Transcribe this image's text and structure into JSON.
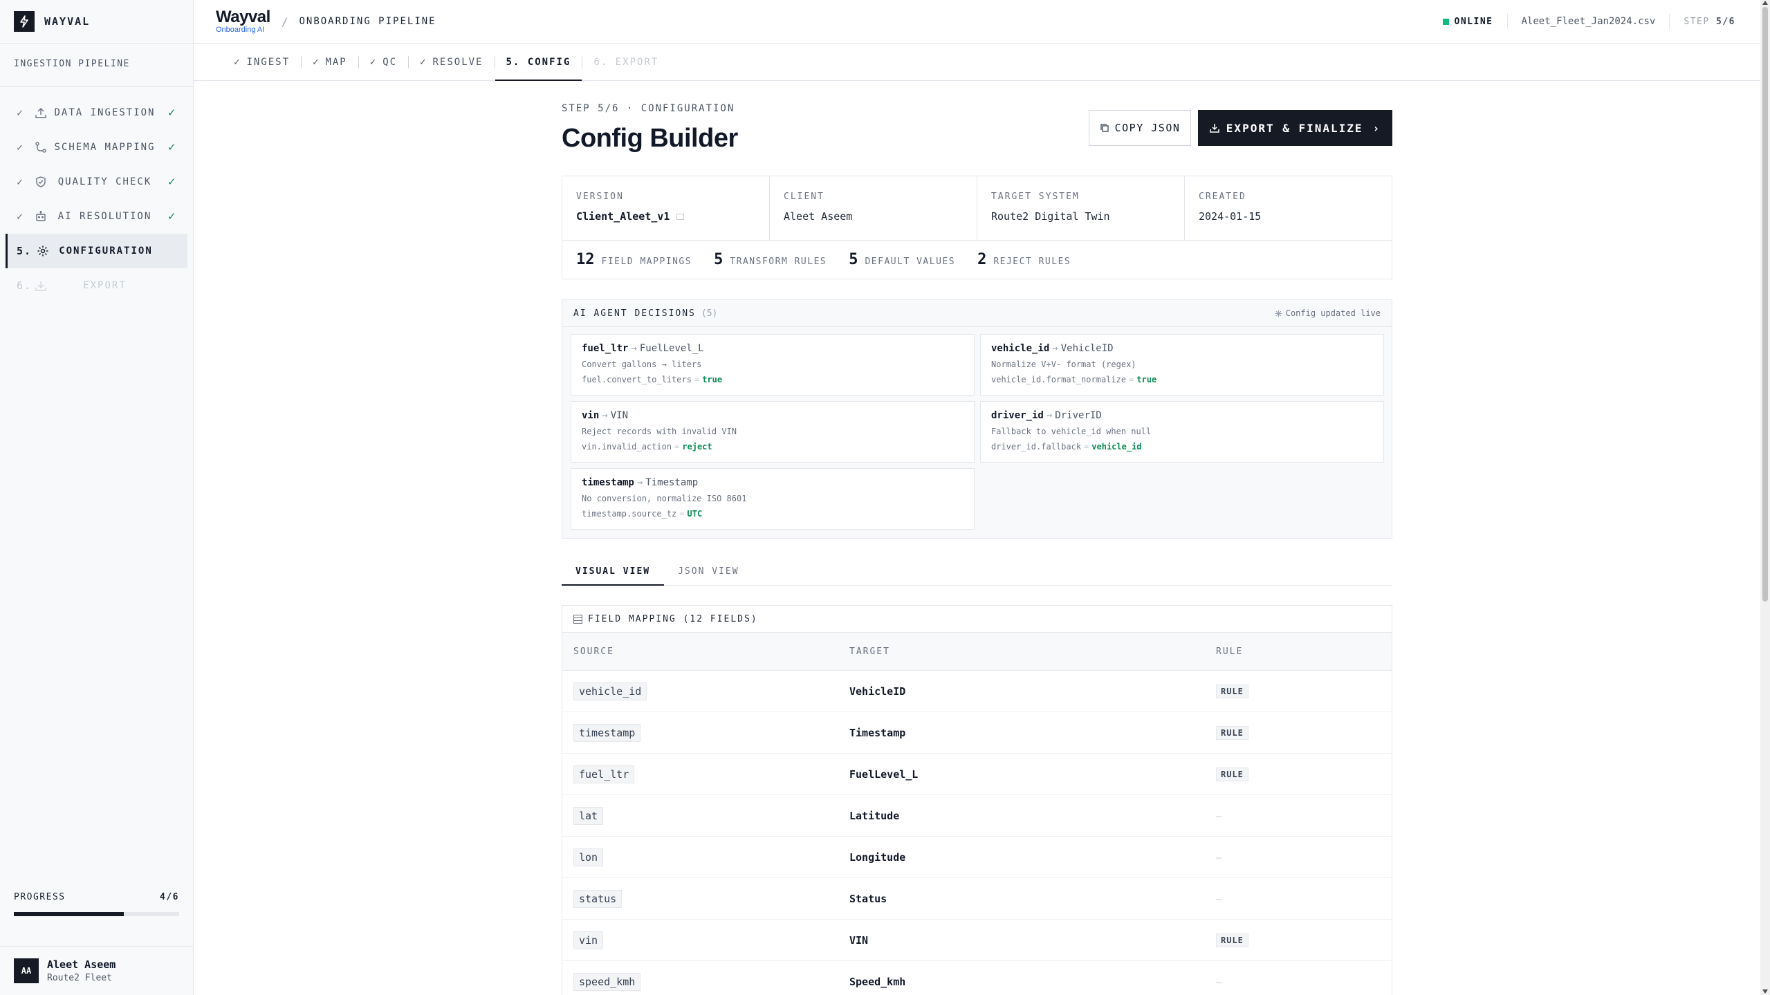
{
  "brand": {
    "name": "WAYVAL",
    "icon": "lightning-bolt-icon"
  },
  "sidebar": {
    "section_title": "INGESTION PIPELINE",
    "items": [
      {
        "prefix": "✓",
        "icon": "upload-icon",
        "label": "DATA INGESTION",
        "done": "✓",
        "state": "done"
      },
      {
        "prefix": "✓",
        "icon": "branch-icon",
        "label": "SCHEMA MAPPING",
        "done": "✓",
        "state": "done"
      },
      {
        "prefix": "✓",
        "icon": "shield-icon",
        "label": "QUALITY CHECK",
        "done": "✓",
        "state": "done"
      },
      {
        "prefix": "✓",
        "icon": "robot-icon",
        "label": "AI RESOLUTION",
        "done": "✓",
        "state": "done"
      },
      {
        "prefix": "5.",
        "icon": "gear-icon",
        "label": "CONFIGURATION",
        "done": "",
        "state": "active"
      },
      {
        "prefix": "6.",
        "icon": "download-icon",
        "label": "EXPORT",
        "done": "",
        "state": "disabled"
      }
    ],
    "progress": {
      "label": "PROGRESS",
      "value": "4/6",
      "fraction": 0.667
    },
    "user": {
      "initials": "AA",
      "name": "Aleet Aseem",
      "org": "Route2 Fleet"
    }
  },
  "header": {
    "logo_title": "Wayval",
    "logo_subtitle": "Onboarding AI",
    "breadcrumb": "ONBOARDING PIPELINE",
    "status": "ONLINE",
    "file": "Aleet_Fleet_Jan2024.csv",
    "step_label": "STEP",
    "step_value": "5/6"
  },
  "tabs": [
    {
      "label": "INGEST",
      "check": "✓",
      "state": "done"
    },
    {
      "label": "MAP",
      "check": "✓",
      "state": "done"
    },
    {
      "label": "QC",
      "check": "✓",
      "state": "done"
    },
    {
      "label": "RESOLVE",
      "check": "✓",
      "state": "done"
    },
    {
      "label": "5. CONFIG",
      "check": "",
      "state": "active"
    },
    {
      "label": "6. EXPORT",
      "check": "",
      "state": "disabled"
    }
  ],
  "main": {
    "eyebrow": "STEP 5/6 · CONFIGURATION",
    "title": "Config Builder",
    "copy_button": "COPY JSON",
    "export_button": "EXPORT & FINALIZE",
    "meta": [
      {
        "key": "VERSION",
        "value": "Client_Aleet_v1"
      },
      {
        "key": "CLIENT",
        "value": "Aleet Aseem"
      },
      {
        "key": "TARGET SYSTEM",
        "value": "Route2 Digital Twin"
      },
      {
        "key": "CREATED",
        "value": "2024-01-15"
      }
    ],
    "stats": [
      {
        "num": "12",
        "label": "FIELD MAPPINGS"
      },
      {
        "num": "5",
        "label": "TRANSFORM RULES"
      },
      {
        "num": "5",
        "label": "DEFAULT VALUES"
      },
      {
        "num": "2",
        "label": "REJECT RULES"
      }
    ],
    "ai": {
      "title": "AI AGENT DECISIONS",
      "count": "(5)",
      "live": "Config updated live",
      "decisions": [
        {
          "source": "fuel_ltr",
          "target": "FuelLevel_L",
          "desc": "Convert gallons → liters",
          "key": "fuel.convert_to_liters",
          "value": "true"
        },
        {
          "source": "vehicle_id",
          "target": "VehicleID",
          "desc": "Normalize V+V- format (regex)",
          "key": "vehicle_id.format_normalize",
          "value": "true"
        },
        {
          "source": "vin",
          "target": "VIN",
          "desc": "Reject records with invalid VIN",
          "key": "vin.invalid_action",
          "value": "reject"
        },
        {
          "source": "driver_id",
          "target": "DriverID",
          "desc": "Fallback to vehicle_id when null",
          "key": "driver_id.fallback",
          "value": "vehicle_id"
        },
        {
          "source": "timestamp",
          "target": "Timestamp",
          "desc": "No conversion, normalize ISO 8601",
          "key": "timestamp.source_tz",
          "value": "UTC"
        }
      ]
    },
    "view_tabs": [
      "VISUAL VIEW",
      "JSON VIEW"
    ],
    "field_mapping": {
      "title": "FIELD MAPPING (12 FIELDS)",
      "columns": [
        "SOURCE",
        "TARGET",
        "RULE"
      ],
      "rows": [
        {
          "source": "vehicle_id",
          "target": "VehicleID",
          "rule": "RULE"
        },
        {
          "source": "timestamp",
          "target": "Timestamp",
          "rule": "RULE"
        },
        {
          "source": "fuel_ltr",
          "target": "FuelLevel_L",
          "rule": "RULE"
        },
        {
          "source": "lat",
          "target": "Latitude",
          "rule": "—"
        },
        {
          "source": "lon",
          "target": "Longitude",
          "rule": "—"
        },
        {
          "source": "status",
          "target": "Status",
          "rule": "—"
        },
        {
          "source": "vin",
          "target": "VIN",
          "rule": "RULE"
        },
        {
          "source": "speed_kmh",
          "target": "Speed_kmh",
          "rule": "—"
        }
      ]
    }
  }
}
